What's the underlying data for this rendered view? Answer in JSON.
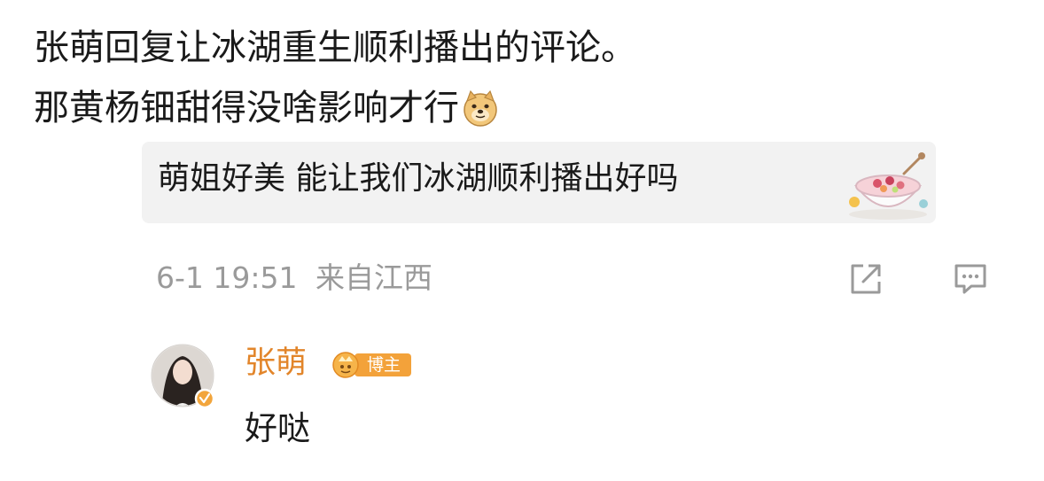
{
  "caption": {
    "line1": "张萌回复让冰湖重生顺利播出的评论。",
    "line2": "那黄杨钿甜得没啥影响才行",
    "emoji_icon": "doge-emoji-icon"
  },
  "comment": {
    "text": "萌姐好美 能让我们冰湖顺利播出好吗",
    "sticker_icon": "dessert-bowl-sticker-icon",
    "timestamp": "6-1 19:51",
    "location": "来自江西",
    "share_icon": "share-icon",
    "reply_icon": "comment-icon"
  },
  "reply": {
    "author": "张萌",
    "badge": "博主",
    "text": "好哒",
    "verified_icon": "verified-icon"
  },
  "colors": {
    "text": "#1a1a1a",
    "meta_gray": "#9a9a9a",
    "bubble_bg": "#f2f2f2",
    "author_orange": "#e2852a",
    "badge_orange": "#f3a23a"
  }
}
